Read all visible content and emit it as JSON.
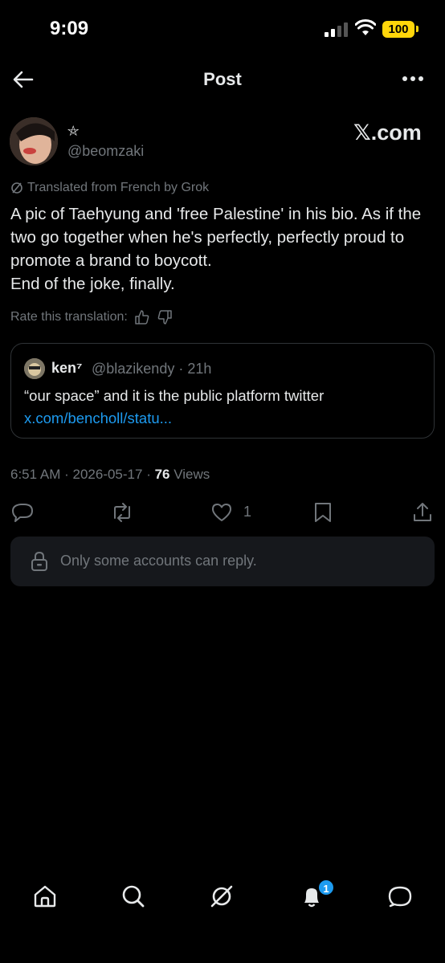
{
  "status_bar": {
    "time": "9:09",
    "battery": "100"
  },
  "header": {
    "title": "Post"
  },
  "author": {
    "display_name": "⛤",
    "handle": "@beomzaki",
    "source_label": "𝕏.com"
  },
  "translation": {
    "label": "Translated from French by Grok",
    "rate_label": "Rate this translation:"
  },
  "post": {
    "text": "A pic of Taehyung and 'free Palestine' in his bio. As if the two go together when he's perfectly, perfectly proud to promote a brand to boycott.\nEnd of the joke, finally."
  },
  "quote": {
    "name": "ken⁷",
    "meta": "@blazikendy · 21h",
    "text": "“our space” and it is the public platform twitter",
    "link": "x.com/bencholl/statu..."
  },
  "meta": {
    "time": "6:51 AM",
    "date": "2026-05-17",
    "views": "76",
    "views_label": "Views"
  },
  "actions": {
    "like_count": "1"
  },
  "reply_restriction": "Only some accounts can reply.",
  "tabbar": {
    "notification_count": "1"
  },
  "icons": [
    "back-arrow-icon",
    "more-icon",
    "grok-icon",
    "thumbs-up-icon",
    "thumbs-down-icon",
    "reply-icon",
    "repost-icon",
    "like-icon",
    "bookmark-icon",
    "share-icon",
    "lock-icon",
    "home-icon",
    "search-icon",
    "grok-tab-icon",
    "bell-icon",
    "messages-icon"
  ],
  "colors": {
    "accent": "#1d9bf0",
    "muted": "#71767b",
    "battery": "#ffd60a"
  }
}
